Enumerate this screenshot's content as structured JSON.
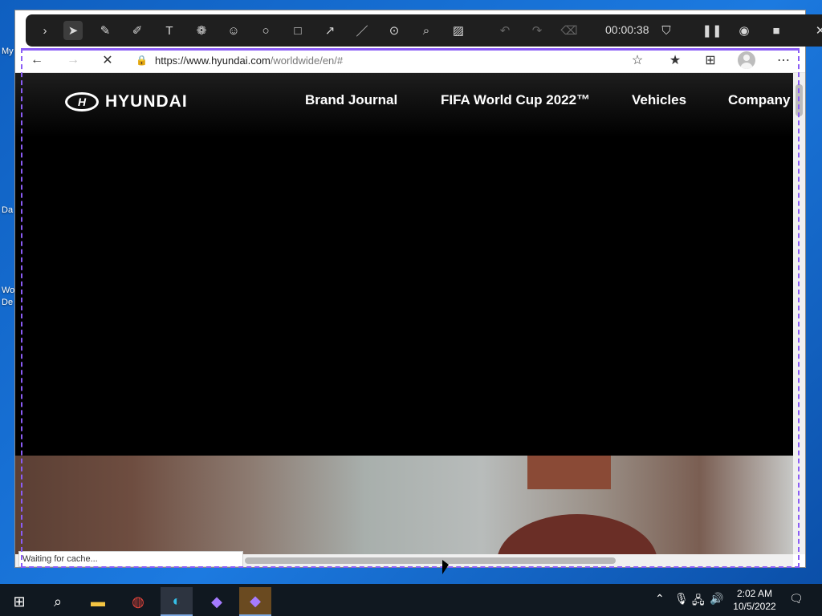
{
  "desktop": {
    "icons": [
      "My",
      "Da",
      "Wo",
      "De"
    ]
  },
  "capture_toolbar": {
    "timer": "00:00:38",
    "tools": [
      "expand-icon",
      "select-icon",
      "pen-icon",
      "highlighter-icon",
      "text-icon",
      "color-icon",
      "emoji-icon",
      "circle-icon",
      "rectangle-icon",
      "arrow-icon",
      "line-icon",
      "focus-icon",
      "magnifier-icon",
      "blur-icon",
      "undo-icon",
      "redo-icon",
      "eraser-icon",
      "pin-icon",
      "pause-icon",
      "webcam-icon",
      "stop-icon",
      "close-icon"
    ]
  },
  "browser": {
    "url": {
      "host": "https://www.hyundai.com",
      "path": "/worldwide/en/#"
    },
    "status": "Waiting for cache..."
  },
  "site": {
    "logo_text": "HYUNDAI",
    "nav": [
      "Brand Journal",
      "FIFA World Cup 2022™",
      "Vehicles",
      "Company"
    ]
  },
  "taskbar": {
    "time": "2:02 AM",
    "date": "10/5/2022"
  },
  "colors": {
    "selection": "#8b5cf6",
    "page_bg": "#000000"
  }
}
